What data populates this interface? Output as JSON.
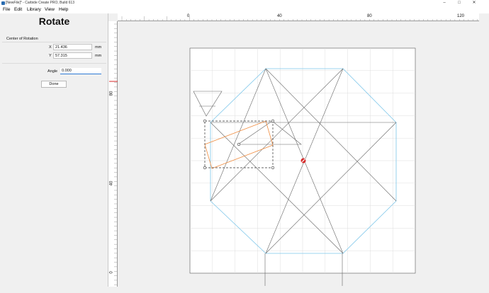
{
  "window": {
    "title": "[NewFile]* - Carbide Create PRO, Build 613",
    "controls": [
      "minimize-icon",
      "maximize-icon",
      "close-icon"
    ]
  },
  "menu": {
    "items": [
      "File",
      "Edit",
      "Library",
      "View",
      "Help"
    ]
  },
  "panel": {
    "title": "Rotate",
    "section_label": "Center of Rotation",
    "x_label": "X",
    "x_value": "21.436",
    "y_label": "Y",
    "y_value": "57.315",
    "unit": "mm",
    "angle_label": "Angle",
    "angle_value": "0.000",
    "done_label": "Done"
  },
  "rulers": {
    "top_labels": [
      "0",
      "40",
      "80",
      "120"
    ],
    "left_labels": [
      "80",
      "40",
      "0"
    ]
  },
  "colors": {
    "outline": "#666666",
    "preview": "#7cc6ea",
    "selected": "#f08a3c",
    "grid": "#dddddd",
    "rotation_center": "#d62a2a",
    "accent": "#2b78d4"
  }
}
